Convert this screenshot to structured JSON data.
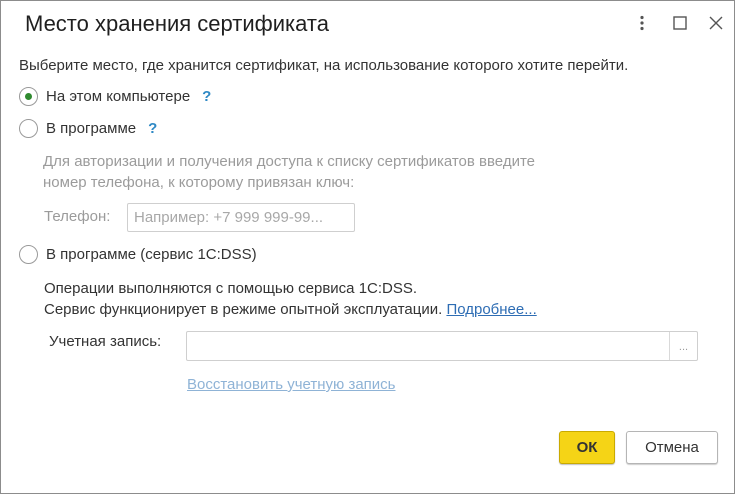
{
  "window": {
    "title": "Место хранения сертификата"
  },
  "prompt": "Выберите место, где хранится сертификат, на использование которого хотите перейти.",
  "options": [
    {
      "label": "На этом компьютере",
      "selected": true,
      "help": "?"
    },
    {
      "label": "В программе",
      "selected": false,
      "help": "?"
    },
    {
      "label": "В программе (сервис 1С:DSS)",
      "selected": false
    }
  ],
  "program_section": {
    "hint_line1": "Для авторизации и получения доступа к списку сертификатов введите",
    "hint_line2": "номер телефона, к которому привязан ключ:",
    "phone_label": "Телефон:",
    "phone_placeholder": "Например: +7 999 999-99..."
  },
  "dss_section": {
    "info_line1": "Операции выполняются с помощью сервиса 1С:DSS.",
    "info_line2": "Сервис функционирует в режиме опытной эксплуатации.",
    "more_link": "Подробнее...",
    "account_label": "Учетная запись:",
    "account_value": "",
    "select_button": "...",
    "restore_link": "Восстановить учетную запись"
  },
  "buttons": {
    "ok": "ОК",
    "cancel": "Отмена"
  },
  "colors": {
    "accent_ok": "#f5d416",
    "radio_selected": "#2f8a2f",
    "help": "#2e89c5",
    "link": "#2e6db4"
  },
  "icons": [
    "more-vertical-icon",
    "maximize-icon",
    "close-icon",
    "help-icon"
  ]
}
